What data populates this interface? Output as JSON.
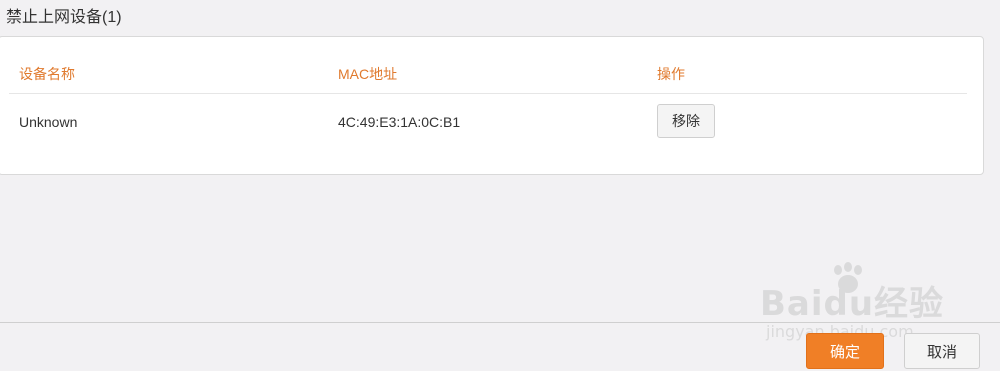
{
  "section": {
    "title": "禁止上网设备(1)"
  },
  "table": {
    "headers": {
      "device_name": "设备名称",
      "mac_address": "MAC地址",
      "action": "操作"
    },
    "rows": [
      {
        "device_name": "Unknown",
        "mac_address": "4C:49:E3:1A:0C:B1",
        "action_label": "移除"
      }
    ]
  },
  "footer": {
    "confirm_label": "确定",
    "cancel_label": "取消"
  },
  "watermark": {
    "brand": "Baidu经验",
    "url": "jingyan.baidu.com"
  },
  "colors": {
    "header_text": "#e07a2e",
    "confirm_button": "#f07f26"
  }
}
